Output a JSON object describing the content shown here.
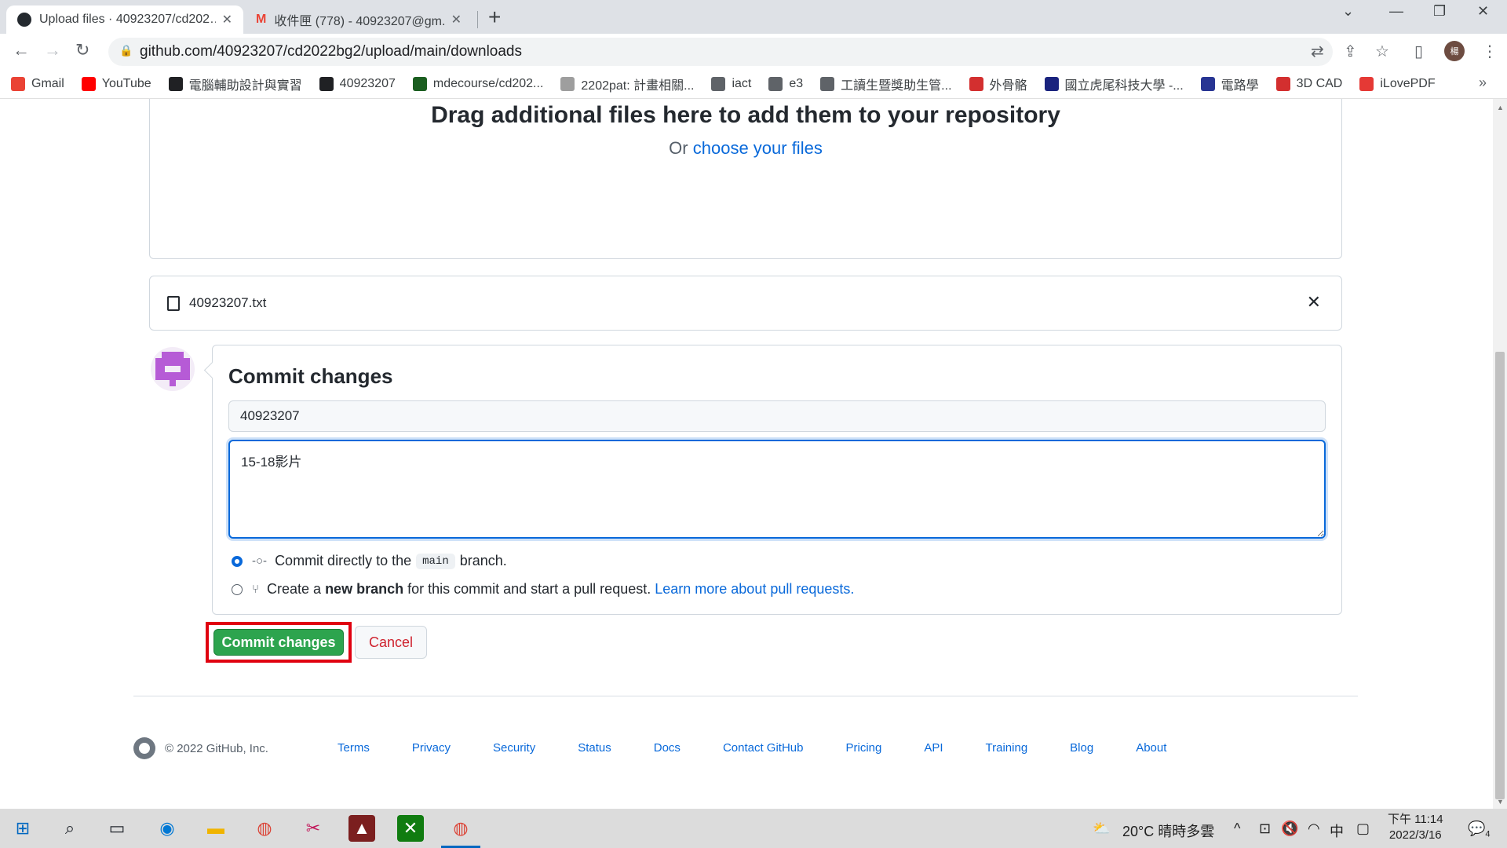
{
  "browser": {
    "tabs": [
      {
        "title": "Upload files · 40923207/cd202…",
        "icon": "github-icon"
      },
      {
        "title": "收件匣 (778) - 40923207@gm...",
        "icon": "gmail-icon"
      }
    ],
    "url": "github.com/40923207/cd2022bg2/upload/main/downloads",
    "profile_initial": "楊",
    "bookmarks": [
      {
        "label": "Gmail",
        "icon": "gmail-icon",
        "color": "#ea4335"
      },
      {
        "label": "YouTube",
        "icon": "youtube-icon",
        "color": "#ff0000"
      },
      {
        "label": "電腦輔助設計與實習",
        "icon": "bookmark-icon",
        "color": "#202124"
      },
      {
        "label": "40923207",
        "icon": "github-icon",
        "color": "#202124"
      },
      {
        "label": "mdecourse/cd202...",
        "icon": "bookmark-icon",
        "color": "#1b5e20"
      },
      {
        "label": "2202pat: 計畫相關...",
        "icon": "bookmark-icon",
        "color": "#9e9e9e"
      },
      {
        "label": "iact",
        "icon": "globe-icon",
        "color": "#5f6368"
      },
      {
        "label": "e3",
        "icon": "globe-icon",
        "color": "#5f6368"
      },
      {
        "label": "工讀生暨獎助生管...",
        "icon": "globe-icon",
        "color": "#5f6368"
      },
      {
        "label": "外骨骼",
        "icon": "gc-icon",
        "color": "#d32f2f"
      },
      {
        "label": "國立虎尾科技大學 -...",
        "icon": "bookmark-icon",
        "color": "#1a237e"
      },
      {
        "label": "電路學",
        "icon": "bookmark-icon",
        "color": "#283593"
      },
      {
        "label": "3D CAD",
        "icon": "gc-icon",
        "color": "#d32f2f"
      },
      {
        "label": "iLovePDF",
        "icon": "heart-icon",
        "color": "#e53935"
      }
    ]
  },
  "upload": {
    "drop_title": "Drag additional files here to add them to your repository",
    "drop_prefix": "Or ",
    "drop_link": "choose your files",
    "file_name": "40923207.txt"
  },
  "commit": {
    "heading": "Commit changes",
    "summary_value": "40923207",
    "description_value": "15-18影片",
    "option_direct_pre": "Commit directly to the",
    "option_direct_branch": "main",
    "option_direct_post": "branch.",
    "option_new_pre": "Create a ",
    "option_new_bold": "new branch",
    "option_new_post": " for this commit and start a pull request. ",
    "option_new_link": "Learn more about pull requests.",
    "commit_button": "Commit changes",
    "cancel_button": "Cancel"
  },
  "footer": {
    "copyright": "© 2022 GitHub, Inc.",
    "links": [
      "Terms",
      "Privacy",
      "Security",
      "Status",
      "Docs",
      "Contact GitHub",
      "Pricing",
      "API",
      "Training",
      "Blog",
      "About"
    ]
  },
  "taskbar": {
    "weather": "20°C  晴時多雲",
    "ime": "中",
    "time": "下午 11:14",
    "date": "2022/3/16",
    "notifications": "4"
  },
  "colors": {
    "primary_green": "#2da44e",
    "link_blue": "#0969da",
    "cancel_red": "#cf222e",
    "highlight_red": "#e00010"
  }
}
